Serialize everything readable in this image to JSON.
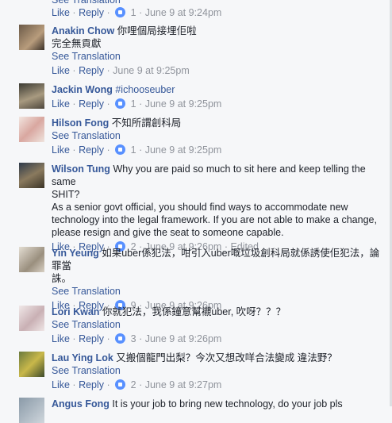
{
  "top": {
    "see_translation_partial": "See Translation",
    "like": "Like",
    "reply": "Reply",
    "count": "1",
    "time": "June 9 at 9:24pm"
  },
  "comments": [
    {
      "name": "Anakin Chow",
      "text": [
        "你哩個局接埋佢啦",
        "完全無貢獻"
      ],
      "see_translation": "See Translation",
      "like": "Like",
      "reply": "Reply",
      "count": "",
      "time": "June 9 at 9:25pm",
      "edited": ""
    },
    {
      "name": "Jackin Wong",
      "text": [
        "#ichooseuber"
      ],
      "see_translation": "",
      "like": "Like",
      "reply": "Reply",
      "count": "1",
      "time": "June 9 at 9:25pm",
      "edited": ""
    },
    {
      "name": "Hilson Fong",
      "text": [
        "不知所謂創科局"
      ],
      "see_translation": "See Translation",
      "like": "Like",
      "reply": "Reply",
      "count": "1",
      "time": "June 9 at 9:25pm",
      "edited": ""
    },
    {
      "name": "Wilson Tung",
      "text": [
        "Why you are paid so much to sit here and keep telling the same",
        "SHIT?",
        "As a senior govt official, you should find ways to accommodate new",
        "technology into the legal framework. If you are not able to make a change,",
        "please resign and give the seat to someone capable."
      ],
      "see_translation": "",
      "like": "Like",
      "reply": "Reply",
      "count": "2",
      "time": "June 9 at 9:26pm",
      "edited": "Edited"
    },
    {
      "name": "Yin Yeung",
      "text": [
        "如果uber係犯法，咁引入uber嘅垃圾創科局就係誘使佢犯法，論罪當",
        "誅。"
      ],
      "see_translation": "See Translation",
      "like": "Like",
      "reply": "Reply",
      "count": "9",
      "time": "June 9 at 9:26pm",
      "edited": ""
    },
    {
      "name": "Lori Kwan",
      "text": [
        "你就犯法，我係鐘意幫襯uber, 吹呀？？？"
      ],
      "see_translation": "See Translation",
      "like": "Like",
      "reply": "Reply",
      "count": "3",
      "time": "June 9 at 9:26pm",
      "edited": ""
    },
    {
      "name": "Lau Ying Lok",
      "text": [
        "又搬個龍門出梨？今次又想改咩合法變成 違法野？"
      ],
      "see_translation": "See Translation",
      "like": "Like",
      "reply": "Reply",
      "count": "2",
      "time": "June 9 at 9:27pm",
      "edited": ""
    },
    {
      "name": "Angus Fong",
      "text": [
        "It is your job to bring new technology, do your job pls"
      ],
      "see_translation": "",
      "like": "",
      "reply": "",
      "count": "",
      "time": "",
      "edited": ""
    }
  ],
  "colors": {
    "link": "#365899",
    "meta": "#90949c",
    "reaction": "#5890ff",
    "background": "#f6f7f9"
  }
}
